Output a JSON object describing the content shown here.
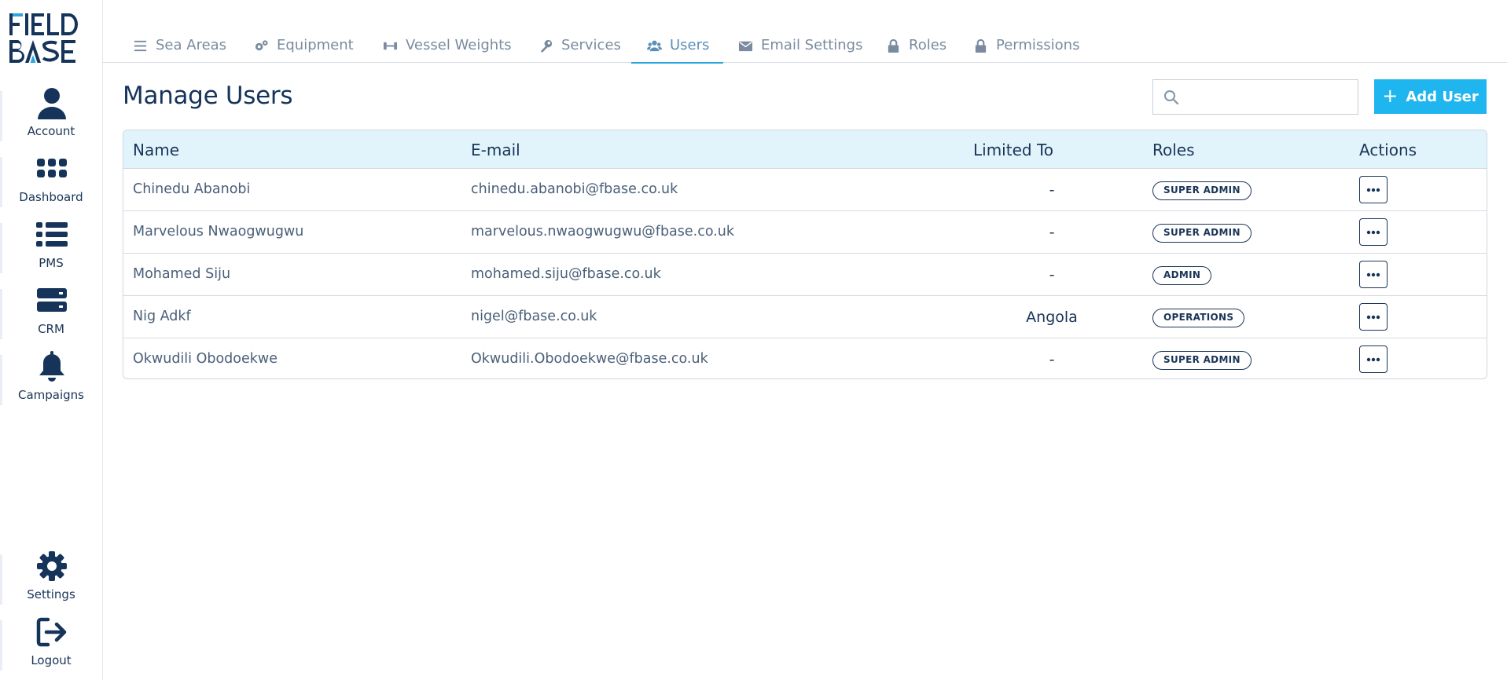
{
  "brand": {
    "line1": "FIELD",
    "line2": "BASE"
  },
  "sidebar": {
    "items": [
      {
        "label": "Account",
        "icon": "user-icon"
      },
      {
        "label": "Dashboard",
        "icon": "grid-icon"
      },
      {
        "label": "PMS",
        "icon": "list-icon"
      },
      {
        "label": "CRM",
        "icon": "server-icon"
      },
      {
        "label": "Campaigns",
        "icon": "bell-icon"
      }
    ],
    "bottom": [
      {
        "label": "Settings",
        "icon": "gear-icon"
      },
      {
        "label": "Logout",
        "icon": "logout-icon"
      }
    ]
  },
  "tabs": [
    {
      "label": "Sea Areas",
      "icon": "lines-icon",
      "active": false
    },
    {
      "label": "Equipment",
      "icon": "gears-icon",
      "active": false
    },
    {
      "label": "Vessel Weights",
      "icon": "dumbbell-icon",
      "active": false
    },
    {
      "label": "Services",
      "icon": "wrench-icon",
      "active": false
    },
    {
      "label": "Users",
      "icon": "users-icon",
      "active": true
    },
    {
      "label": "Email Settings",
      "icon": "envelope-icon",
      "active": false
    },
    {
      "label": "Roles",
      "icon": "lock-icon",
      "active": false
    },
    {
      "label": "Permissions",
      "icon": "lock-icon",
      "active": false
    }
  ],
  "page": {
    "title": "Manage Users",
    "search_placeholder": "",
    "add_label": "Add User"
  },
  "table": {
    "columns": {
      "name": "Name",
      "email": "E-mail",
      "limited": "Limited To",
      "roles": "Roles",
      "actions": "Actions"
    },
    "rows": [
      {
        "name": "Chinedu Abanobi",
        "email": "chinedu.abanobi@fbase.co.uk",
        "limited": "-",
        "role": "SUPER ADMIN"
      },
      {
        "name": "Marvelous Nwaogwugwu",
        "email": "marvelous.nwaogwugwu@fbase.co.uk",
        "limited": "-",
        "role": "SUPER ADMIN"
      },
      {
        "name": "Mohamed Siju",
        "email": "mohamed.siju@fbase.co.uk",
        "limited": "-",
        "role": "ADMIN"
      },
      {
        "name": "Nig Adkf",
        "email": "nigel@fbase.co.uk",
        "limited": "Angola",
        "role": "OPERATIONS"
      },
      {
        "name": "Okwudili Obodoekwe",
        "email": "Okwudili.Obodoekwe@fbase.co.uk",
        "limited": "-",
        "role": "SUPER ADMIN"
      }
    ]
  },
  "colors": {
    "navy": "#1a3557",
    "accent": "#1fb5ee",
    "header_bg": "#e1f4fc",
    "tab_inactive": "#7a8ba0",
    "tab_active": "#5c8fb8"
  }
}
